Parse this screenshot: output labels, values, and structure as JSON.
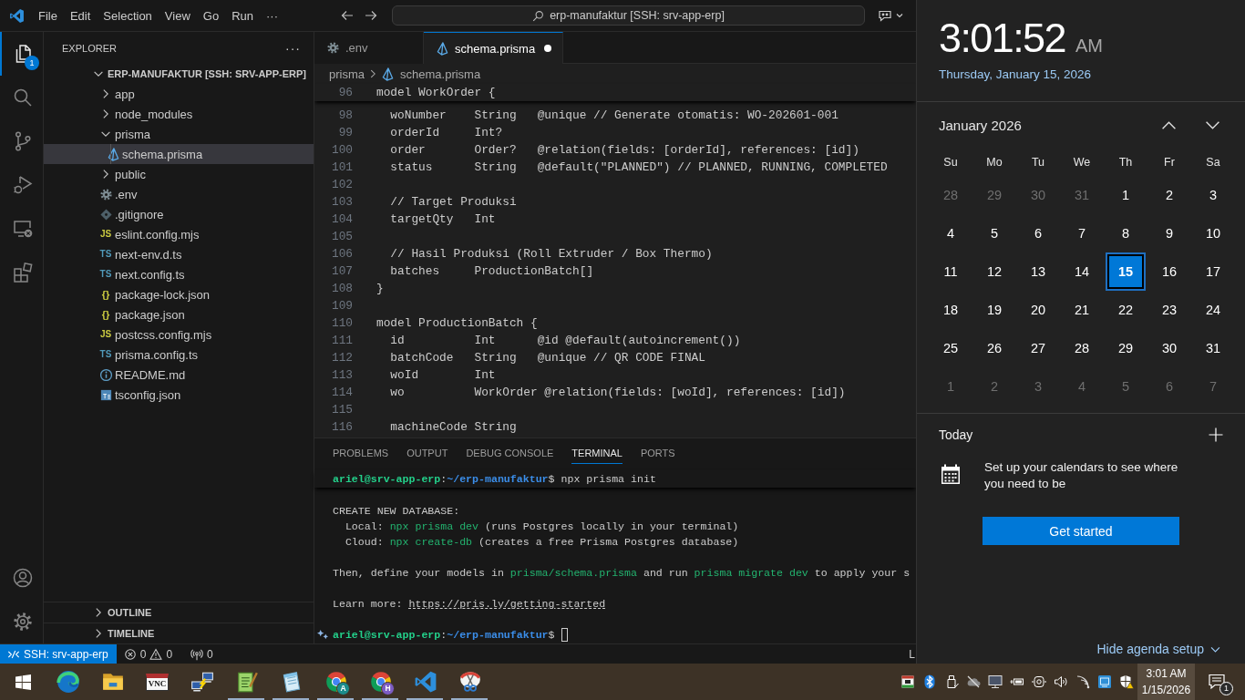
{
  "title_bar": {
    "menus": [
      "File",
      "Edit",
      "Selection",
      "View",
      "Go",
      "Run",
      "···"
    ],
    "command_center": "erp-manufaktur [SSH: srv-app-erp]"
  },
  "activity_bar": {
    "items": [
      {
        "kind": "explorer",
        "selected": true,
        "badge": "1"
      },
      {
        "kind": "search",
        "selected": false
      },
      {
        "kind": "source_control",
        "selected": false
      },
      {
        "kind": "run_debug",
        "selected": false
      },
      {
        "kind": "remote",
        "selected": false
      },
      {
        "kind": "extensions",
        "selected": false
      }
    ],
    "bottom": [
      {
        "kind": "account"
      },
      {
        "kind": "settings"
      }
    ]
  },
  "explorer": {
    "title": "EXPLORER",
    "more": "···",
    "root": {
      "label": "ERP-MANUFAKTUR [SSH: SRV-APP-ERP]",
      "expanded": true,
      "children": [
        {
          "label": "app",
          "kind": "folder",
          "expanded": false,
          "selected": false
        },
        {
          "label": "node_modules",
          "kind": "folder",
          "expanded": false,
          "selected": false
        },
        {
          "label": "prisma",
          "kind": "folder",
          "expanded": true,
          "selected": false,
          "children": [
            {
              "label": "schema.prisma",
              "kind": "prisma",
              "selected": true
            }
          ]
        },
        {
          "label": "public",
          "kind": "folder",
          "expanded": false,
          "selected": false
        },
        {
          "label": ".env",
          "kind": "env",
          "selected": false
        },
        {
          "label": ".gitignore",
          "kind": "gitignore",
          "selected": false
        },
        {
          "label": "eslint.config.mjs",
          "kind": "js",
          "icon_text": "JS",
          "selected": false
        },
        {
          "label": "next-env.d.ts",
          "kind": "ts",
          "icon_text": "TS",
          "selected": false
        },
        {
          "label": "next.config.ts",
          "kind": "ts",
          "icon_text": "TS",
          "selected": false
        },
        {
          "label": "package-lock.json",
          "kind": "json",
          "icon_text": "{}",
          "selected": false
        },
        {
          "label": "package.json",
          "kind": "json",
          "icon_text": "{}",
          "selected": false
        },
        {
          "label": "postcss.config.mjs",
          "kind": "js",
          "icon_text": "JS",
          "selected": false
        },
        {
          "label": "prisma.config.ts",
          "kind": "ts",
          "icon_text": "TS",
          "selected": false
        },
        {
          "label": "README.md",
          "kind": "markdown",
          "selected": false
        },
        {
          "label": "tsconfig.json",
          "kind": "tsconfig",
          "selected": false
        }
      ]
    },
    "sections": [
      {
        "label": "OUTLINE",
        "expanded": false
      },
      {
        "label": "TIMELINE",
        "expanded": false
      }
    ]
  },
  "editor": {
    "tabs": [
      {
        "label": ".env",
        "kind": "env",
        "selected": false,
        "modified": false
      },
      {
        "label": "schema.prisma",
        "kind": "prisma",
        "selected": true,
        "modified": true
      }
    ],
    "breadcrumbs": [
      {
        "label": "prisma",
        "kind": "folder"
      },
      {
        "label": "schema.prisma",
        "kind": "prisma"
      }
    ],
    "sticky_line": {
      "number": "96",
      "text": "model WorkOrder {"
    },
    "lines": [
      {
        "number": "98",
        "text": "  woNumber    String   @unique // Generate otomatis: WO-202601-001"
      },
      {
        "number": "99",
        "text": "  orderId     Int?"
      },
      {
        "number": "100",
        "text": "  order       Order?   @relation(fields: [orderId], references: [id])"
      },
      {
        "number": "101",
        "text": "  status      String   @default(\"PLANNED\") // PLANNED, RUNNING, COMPLETED"
      },
      {
        "number": "102"
      },
      {
        "number": "103",
        "text": "  // Target Produksi"
      },
      {
        "number": "104",
        "text": "  targetQty   Int"
      },
      {
        "number": "105"
      },
      {
        "number": "106",
        "text": "  // Hasil Produksi (Roll Extruder / Box Thermo)"
      },
      {
        "number": "107",
        "text": "  batches     ProductionBatch[]"
      },
      {
        "number": "108",
        "text": "}"
      },
      {
        "number": "109"
      },
      {
        "number": "110",
        "text": "model ProductionBatch {"
      },
      {
        "number": "111",
        "text": "  id          Int      @id @default(autoincrement())"
      },
      {
        "number": "112",
        "text": "  batchCode   String   @unique // QR CODE FINAL"
      },
      {
        "number": "113",
        "text": "  woId        Int"
      },
      {
        "number": "114",
        "text": "  wo          WorkOrder @relation(fields: [woId], references: [id])"
      },
      {
        "number": "115"
      },
      {
        "number": "116",
        "text": "  machineCode String"
      }
    ]
  },
  "panel": {
    "tabs": [
      {
        "label": "PROBLEMS",
        "selected": false
      },
      {
        "label": "OUTPUT",
        "selected": false
      },
      {
        "label": "DEBUG CONSOLE",
        "selected": false
      },
      {
        "label": "TERMINAL",
        "selected": true
      },
      {
        "label": "PORTS",
        "selected": false
      }
    ],
    "terminal": {
      "sticky_line": [
        {
          "kind": "user",
          "text": "ariel@srv-app-erp"
        },
        {
          "kind": "plain",
          "text": ":"
        },
        {
          "kind": "path",
          "text": "~/erp-manufaktur"
        },
        {
          "kind": "plain",
          "text": "$ npx prisma init"
        }
      ],
      "blocks": [
        {
          "lines": [
            [
              {
                "kind": "plain",
                "text": "CREATE NEW DATABASE:"
              }
            ],
            [
              {
                "kind": "plain",
                "text": "  Local: "
              },
              {
                "kind": "cmd",
                "text": "npx prisma dev"
              },
              {
                "kind": "plain",
                "text": " (runs Postgres locally in your terminal)"
              }
            ],
            [
              {
                "kind": "plain",
                "text": "  Cloud: "
              },
              {
                "kind": "cmd",
                "text": "npx create-db"
              },
              {
                "kind": "plain",
                "text": " (creates a free Prisma Postgres database)"
              }
            ]
          ]
        },
        {
          "lines": [
            [
              {
                "kind": "plain",
                "text": "Then, define your models in "
              },
              {
                "kind": "cmd",
                "text": "prisma/schema.prisma"
              },
              {
                "kind": "plain",
                "text": " and run "
              },
              {
                "kind": "cmd",
                "text": "prisma migrate dev"
              },
              {
                "kind": "plain",
                "text": " to apply your s"
              }
            ]
          ]
        },
        {
          "lines": [
            [
              {
                "kind": "plain",
                "text": "Learn more: "
              },
              {
                "kind": "link",
                "text": "https://pris.ly/getting-started"
              }
            ]
          ]
        }
      ],
      "prompt": {
        "segments": [
          {
            "kind": "user",
            "text": "ariel@srv-app-erp"
          },
          {
            "kind": "plain",
            "text": ":"
          },
          {
            "kind": "path",
            "text": "~/erp-manufaktur"
          },
          {
            "kind": "plain",
            "text": "$"
          }
        ],
        "cursor": true
      }
    }
  },
  "status_bar": {
    "remote": "SSH: srv-app-erp",
    "errors": "0",
    "warnings": "0",
    "ports": "0",
    "right_item": "L"
  },
  "calendar_flyout": {
    "time": "3:01:52",
    "period": "AM",
    "date": "Thursday, January 15, 2026",
    "month": "January 2026",
    "weekdays": [
      "Su",
      "Mo",
      "Tu",
      "We",
      "Th",
      "Fr",
      "Sa"
    ],
    "days": [
      {
        "label": "28",
        "outside": true,
        "selected": false
      },
      {
        "label": "29",
        "outside": true,
        "selected": false
      },
      {
        "label": "30",
        "outside": true,
        "selected": false
      },
      {
        "label": "31",
        "outside": true,
        "selected": false
      },
      {
        "label": "1",
        "outside": false,
        "selected": false
      },
      {
        "label": "2",
        "outside": false,
        "selected": false
      },
      {
        "label": "3",
        "outside": false,
        "selected": false
      },
      {
        "label": "4",
        "outside": false,
        "selected": false
      },
      {
        "label": "5",
        "outside": false,
        "selected": false
      },
      {
        "label": "6",
        "outside": false,
        "selected": false
      },
      {
        "label": "7",
        "outside": false,
        "selected": false
      },
      {
        "label": "8",
        "outside": false,
        "selected": false
      },
      {
        "label": "9",
        "outside": false,
        "selected": false
      },
      {
        "label": "10",
        "outside": false,
        "selected": false
      },
      {
        "label": "11",
        "outside": false,
        "selected": false
      },
      {
        "label": "12",
        "outside": false,
        "selected": false
      },
      {
        "label": "13",
        "outside": false,
        "selected": false
      },
      {
        "label": "14",
        "outside": false,
        "selected": false
      },
      {
        "label": "15",
        "outside": false,
        "selected": true
      },
      {
        "label": "16",
        "outside": false,
        "selected": false
      },
      {
        "label": "17",
        "outside": false,
        "selected": false
      },
      {
        "label": "18",
        "outside": false,
        "selected": false
      },
      {
        "label": "19",
        "outside": false,
        "selected": false
      },
      {
        "label": "20",
        "outside": false,
        "selected": false
      },
      {
        "label": "21",
        "outside": false,
        "selected": false
      },
      {
        "label": "22",
        "outside": false,
        "selected": false
      },
      {
        "label": "23",
        "outside": false,
        "selected": false
      },
      {
        "label": "24",
        "outside": false,
        "selected": false
      },
      {
        "label": "25",
        "outside": false,
        "selected": false
      },
      {
        "label": "26",
        "outside": false,
        "selected": false
      },
      {
        "label": "27",
        "outside": false,
        "selected": false
      },
      {
        "label": "28",
        "outside": false,
        "selected": false
      },
      {
        "label": "29",
        "outside": false,
        "selected": false
      },
      {
        "label": "30",
        "outside": false,
        "selected": false
      },
      {
        "label": "31",
        "outside": false,
        "selected": false
      },
      {
        "label": "1",
        "outside": true,
        "selected": false
      },
      {
        "label": "2",
        "outside": true,
        "selected": false
      },
      {
        "label": "3",
        "outside": true,
        "selected": false
      },
      {
        "label": "4",
        "outside": true,
        "selected": false
      },
      {
        "label": "5",
        "outside": true,
        "selected": false
      },
      {
        "label": "6",
        "outside": true,
        "selected": false
      },
      {
        "label": "7",
        "outside": true,
        "selected": false
      }
    ],
    "agenda": {
      "title": "Today",
      "message": "Set up your calendars to see where you need to be",
      "button": "Get started"
    },
    "hide_link": "Hide agenda setup"
  },
  "taskbar": {
    "apps": [
      {
        "kind": "start",
        "running": false
      },
      {
        "kind": "swirl_browser",
        "running": false
      },
      {
        "kind": "folder",
        "running": false
      },
      {
        "kind": "vnc",
        "label": "VNC",
        "running": false
      },
      {
        "kind": "network",
        "running": false
      },
      {
        "kind": "green_notepad",
        "running": true
      },
      {
        "kind": "notepad",
        "running": true
      },
      {
        "kind": "browser",
        "badge": "A",
        "color": "#1b8c8c",
        "running": true
      },
      {
        "kind": "browser",
        "badge": "H",
        "color": "#7c5cc4",
        "running": true
      },
      {
        "kind": "code_editor",
        "running": true
      },
      {
        "kind": "snipping",
        "running": true
      }
    ],
    "tray": [
      {
        "kind": "app_window"
      },
      {
        "kind": "bluetooth"
      },
      {
        "kind": "usb"
      },
      {
        "kind": "cloud_off"
      },
      {
        "kind": "monitor"
      },
      {
        "kind": "battery"
      },
      {
        "kind": "camera"
      },
      {
        "kind": "volume"
      },
      {
        "kind": "wifi"
      },
      {
        "kind": "screen_app"
      },
      {
        "kind": "shield_warning"
      }
    ],
    "clock": {
      "time": "3:01 AM",
      "date": "1/15/2026",
      "selected": true
    },
    "notifications": {
      "badge": "1"
    }
  }
}
